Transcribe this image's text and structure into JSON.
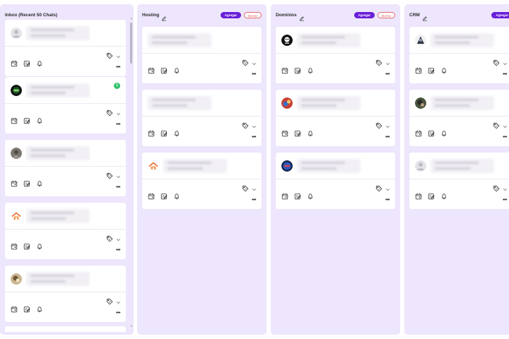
{
  "columns": [
    {
      "title": "Inbox (Recent 50 Chats)",
      "edit_icon": false,
      "buttons": [],
      "cards": [
        {
          "avatar": "default-person",
          "badge": null
        },
        {
          "avatar": "green-logo",
          "badge": "1"
        },
        {
          "avatar": "grey-photo",
          "badge": null
        },
        {
          "avatar": "house-logo",
          "badge": null
        },
        {
          "avatar": "tan-photo",
          "badge": null
        }
      ]
    },
    {
      "title": "Hosting",
      "edit_icon": true,
      "buttons": [
        "Agregar",
        "Borrar"
      ],
      "cards": [
        {
          "avatar": "none",
          "badge": null
        },
        {
          "avatar": "none",
          "badge": null
        },
        {
          "avatar": "house-logo",
          "badge": null
        }
      ]
    },
    {
      "title": "Dominios",
      "edit_icon": true,
      "buttons": [
        "Agregar",
        "Borrar"
      ],
      "cards": [
        {
          "avatar": "black-logo",
          "badge": null
        },
        {
          "avatar": "red-photo",
          "badge": null
        },
        {
          "avatar": "blue-logo",
          "badge": null
        }
      ]
    },
    {
      "title": "CRM",
      "edit_icon": true,
      "buttons": [
        "Agregar"
      ],
      "cards": [
        {
          "avatar": "dark-photo",
          "badge": null
        },
        {
          "avatar": "green-photo",
          "badge": null
        },
        {
          "avatar": "default-person",
          "badge": null
        }
      ]
    }
  ],
  "icons": {
    "card_actions": [
      "calendar-icon",
      "edit-note-icon",
      "bell-icon"
    ],
    "tag": "tag-icon",
    "chevron": "chevron-down-icon",
    "more": "more-options-icon"
  },
  "colors": {
    "column_bg": "#ede6fc",
    "accent": "#6a1fd8",
    "danger": "#e05a5a",
    "badge": "#2fc26b"
  }
}
